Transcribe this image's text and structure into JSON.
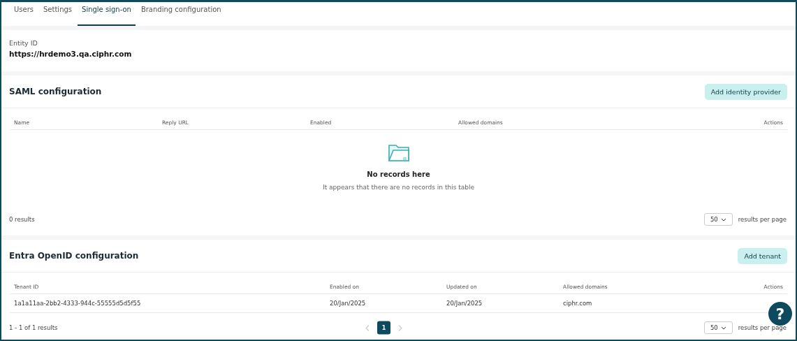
{
  "tabs": [
    {
      "label": "Users",
      "selected": false
    },
    {
      "label": "Settings",
      "selected": false
    },
    {
      "label": "Single sign-on",
      "selected": true
    },
    {
      "label": "Branding configuration",
      "selected": false
    }
  ],
  "entity": {
    "label": "Entity ID",
    "value": "https://hrdemo3.qa.ciphr.com"
  },
  "saml": {
    "title": "SAML configuration",
    "button": "Add identity provider",
    "columns": [
      "Name",
      "Reply URL",
      "Enabled",
      "Allowed domains",
      "Actions"
    ],
    "empty": {
      "title": "No records here",
      "text": "It appears that there are no records in this table"
    },
    "results": "0 results",
    "page_size": "50",
    "per_page": "results per page"
  },
  "entra": {
    "title": "Entra OpenID configuration",
    "button": "Add tenant",
    "columns": [
      "Tenant ID",
      "Enabled on",
      "Updated on",
      "Allowed domains",
      "Actions"
    ],
    "rows": [
      [
        "1a1a11aa-2bb2-4333-944c-55555d5d5f55",
        "20/Jan/2025",
        "20/Jan/2025",
        "ciphr.com"
      ]
    ],
    "results": "1 - 1 of 1 results",
    "pages": [
      {
        "label": "1",
        "selected": true
      }
    ],
    "page_size": "50",
    "per_page": "results per page"
  },
  "help": "?"
}
